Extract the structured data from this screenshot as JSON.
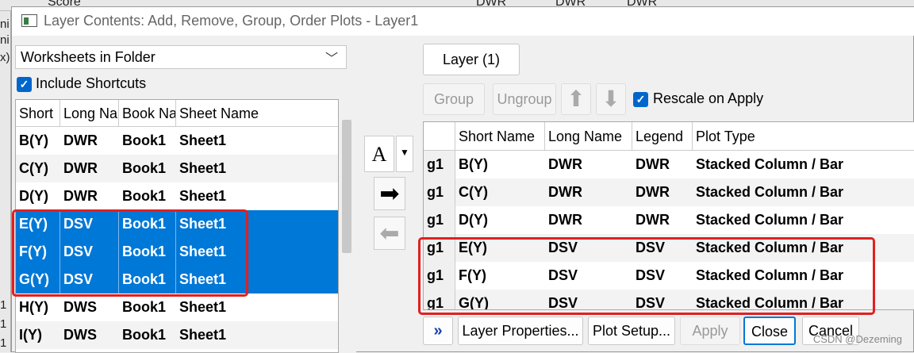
{
  "background": {
    "top_labels": [
      "Score",
      "DWR",
      "DWR",
      "DWR"
    ],
    "left_labels": [
      "ni",
      "ni",
      "x)",
      "1",
      "1",
      "1"
    ]
  },
  "dialog": {
    "title": "Layer Contents: Add, Remove, Group, Order Plots - Layer1",
    "source_select": {
      "value": "Worksheets in Folder"
    },
    "include_shortcuts": {
      "label": "Include Shortcuts",
      "checked": true
    },
    "left_grid": {
      "columns": [
        "Short",
        "Long Na",
        "Book Na",
        "Sheet Name"
      ],
      "rows": [
        {
          "short": "B(Y)",
          "long": "DWR",
          "book": "Book1",
          "sheet": "Sheet1",
          "selected": false
        },
        {
          "short": "C(Y)",
          "long": "DWR",
          "book": "Book1",
          "sheet": "Sheet1",
          "selected": false
        },
        {
          "short": "D(Y)",
          "long": "DWR",
          "book": "Book1",
          "sheet": "Sheet1",
          "selected": false
        },
        {
          "short": "E(Y)",
          "long": "DSV",
          "book": "Book1",
          "sheet": "Sheet1",
          "selected": true
        },
        {
          "short": "F(Y)",
          "long": "DSV",
          "book": "Book1",
          "sheet": "Sheet1",
          "selected": true
        },
        {
          "short": "G(Y)",
          "long": "DSV",
          "book": "Book1",
          "sheet": "Sheet1",
          "selected": true
        },
        {
          "short": "H(Y)",
          "long": "DWS",
          "book": "Book1",
          "sheet": "Sheet1",
          "selected": false
        },
        {
          "short": "I(Y)",
          "long": "DWS",
          "book": "Book1",
          "sheet": "Sheet1",
          "selected": false
        }
      ]
    },
    "middle": {
      "font_button": "A",
      "add_arrow": "➡",
      "remove_arrow": "⬅"
    },
    "layer_tab": "Layer (1)",
    "group_button": "Group",
    "ungroup_button": "Ungroup",
    "rescale": {
      "label": "Rescale on Apply",
      "checked": true
    },
    "right_grid": {
      "columns": [
        "",
        "Short Name",
        "Long Name",
        "Legend",
        "Plot Type"
      ],
      "rows": [
        {
          "group": "g1",
          "short": "B(Y)",
          "long": "DWR",
          "legend": "DWR",
          "type": "Stacked Column / Bar"
        },
        {
          "group": "g1",
          "short": "C(Y)",
          "long": "DWR",
          "legend": "DWR",
          "type": "Stacked Column / Bar"
        },
        {
          "group": "g1",
          "short": "D(Y)",
          "long": "DWR",
          "legend": "DWR",
          "type": "Stacked Column / Bar"
        },
        {
          "group": "g1",
          "short": "E(Y)",
          "long": "DSV",
          "legend": "DSV",
          "type": "Stacked Column / Bar"
        },
        {
          "group": "g1",
          "short": "F(Y)",
          "long": "DSV",
          "legend": "DSV",
          "type": "Stacked Column / Bar"
        },
        {
          "group": "g1",
          "short": "G(Y)",
          "long": "DSV",
          "legend": "DSV",
          "type": "Stacked Column / Bar"
        }
      ]
    },
    "footer": {
      "expand": "»",
      "layer_properties": "Layer Properties...",
      "plot_setup": "Plot Setup...",
      "apply": "Apply",
      "close": "Close",
      "cancel": "Cancel"
    },
    "watermark": "CSDN @Dezeming"
  },
  "colors": {
    "selection": "#0078d7",
    "highlight_box": "#e02020",
    "checkbox": "#0066cc"
  }
}
